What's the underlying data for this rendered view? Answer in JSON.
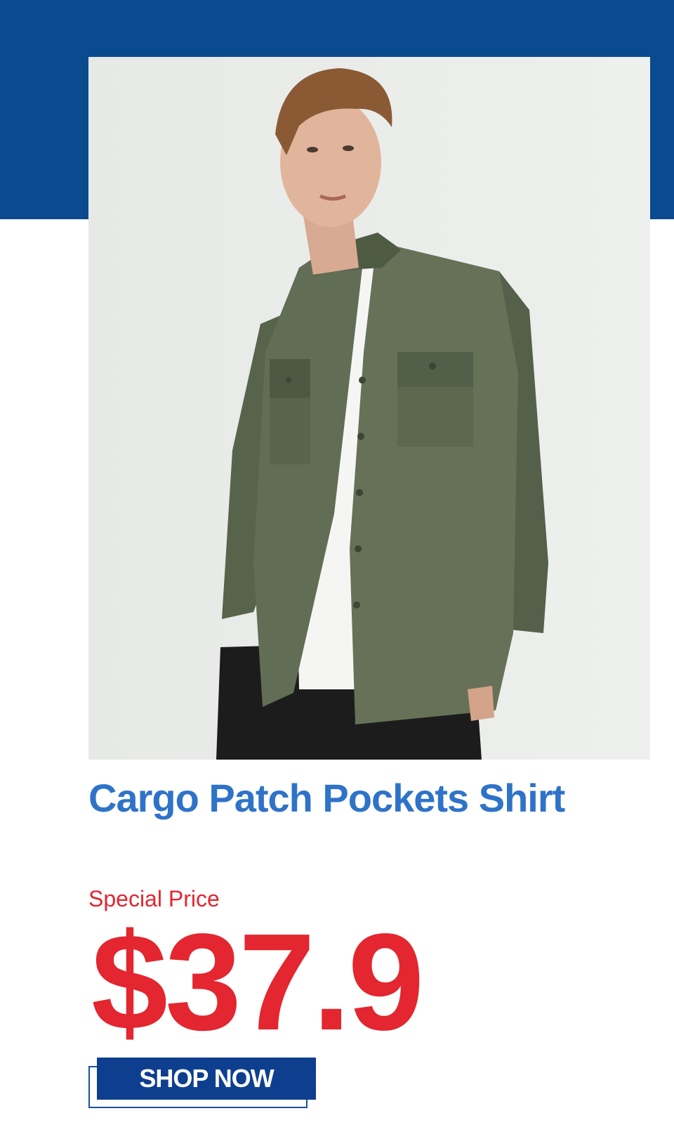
{
  "product": {
    "title": "Cargo Patch Pockets Shirt",
    "price_label": "Special Price",
    "price": "$37.9",
    "cta_label": "SHOP NOW"
  },
  "image": {
    "subject": "model-wearing-olive-shirt-icon"
  },
  "colors": {
    "band": "#0a4a8e",
    "title": "#2f73c8",
    "price": "#e3262f",
    "button": "#0e3f8f",
    "shirt": "#5c6650"
  }
}
